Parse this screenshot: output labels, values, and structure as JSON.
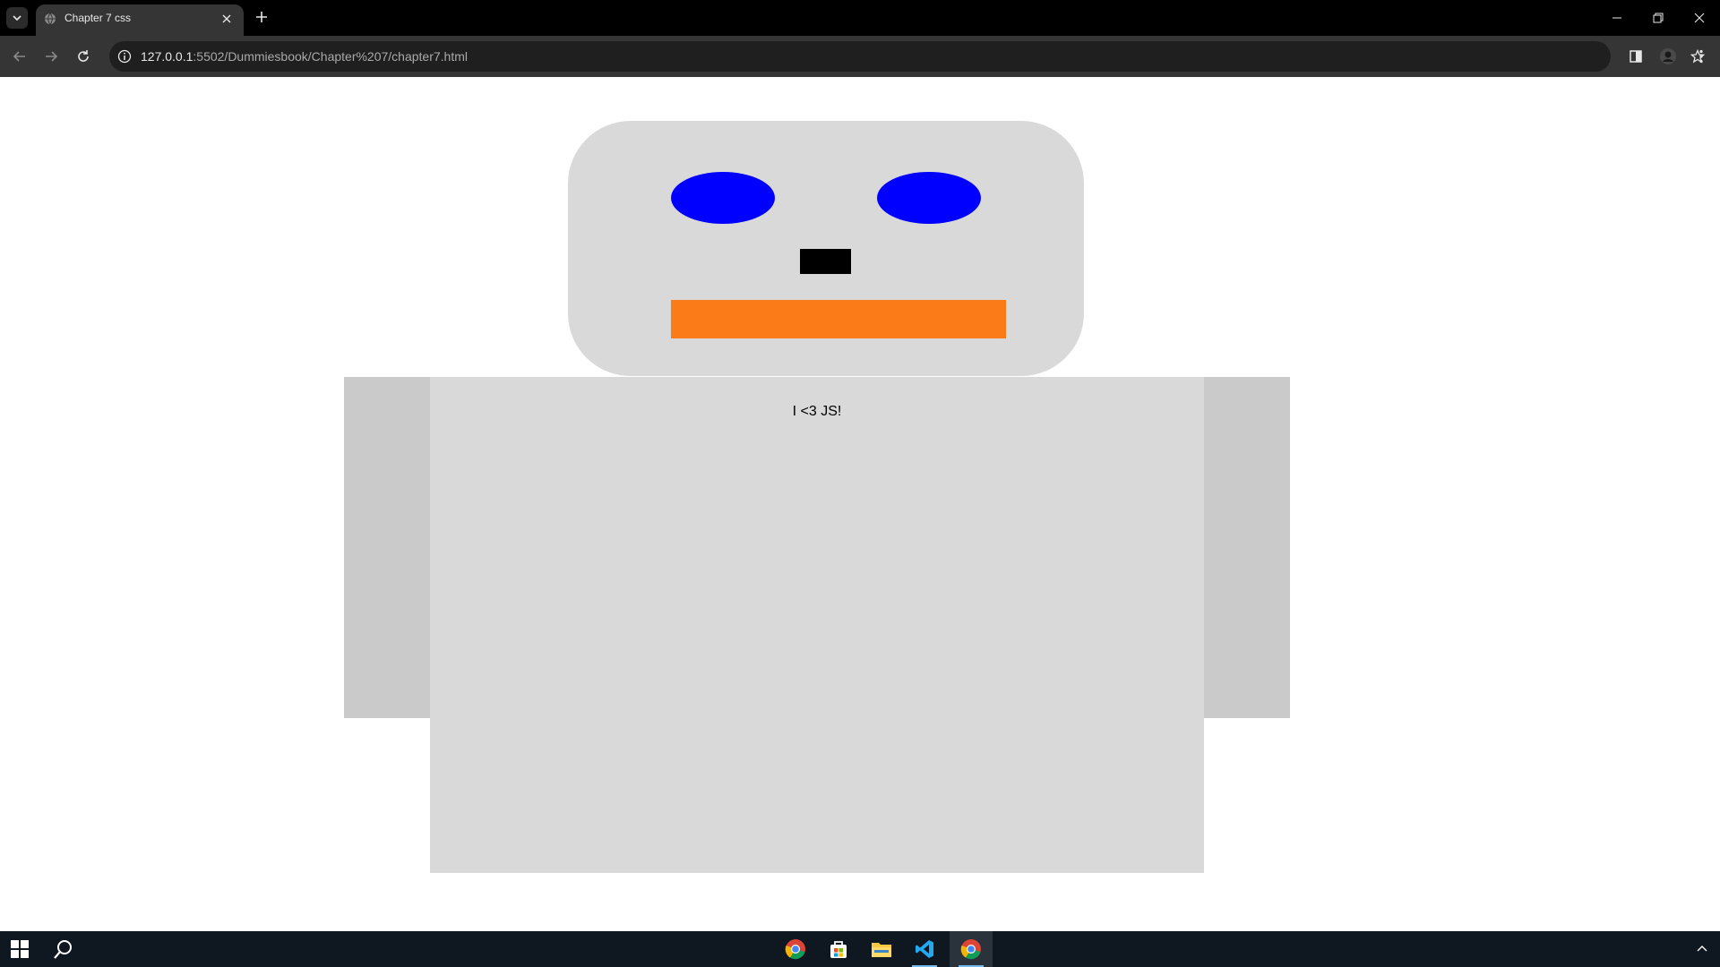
{
  "browser": {
    "tab_title": "Chapter 7 css",
    "url_host": "127.0.0.1",
    "url_rest": ":5502/Dummiesbook/Chapter%207/chapter7.html",
    "icons": {
      "tab_search": "chevron-down-icon",
      "favicon": "globe-icon",
      "tab_close": "close-icon",
      "new_tab": "plus-icon",
      "minimize": "minimize-icon",
      "restore": "restore-icon",
      "close_window": "close-icon",
      "back": "arrow-left-icon",
      "forward": "arrow-right-icon",
      "reload": "reload-icon",
      "site_info": "info-icon",
      "bookmark": "star-icon",
      "side_panel": "side-panel-icon",
      "profile": "avatar-icon",
      "menu": "kebab-menu-icon"
    }
  },
  "page": {
    "body_text": "I <3 JS!",
    "colors": {
      "head": "#d9d9d9",
      "eyes": "#0000ff",
      "nose": "#000000",
      "mouth": "#fa7b17",
      "body": "#d9d9d9",
      "arms": "#cacaca"
    }
  },
  "taskbar": {
    "apps": [
      "chrome",
      "microsoft-store",
      "file-explorer",
      "vs-code",
      "chrome-active"
    ]
  }
}
